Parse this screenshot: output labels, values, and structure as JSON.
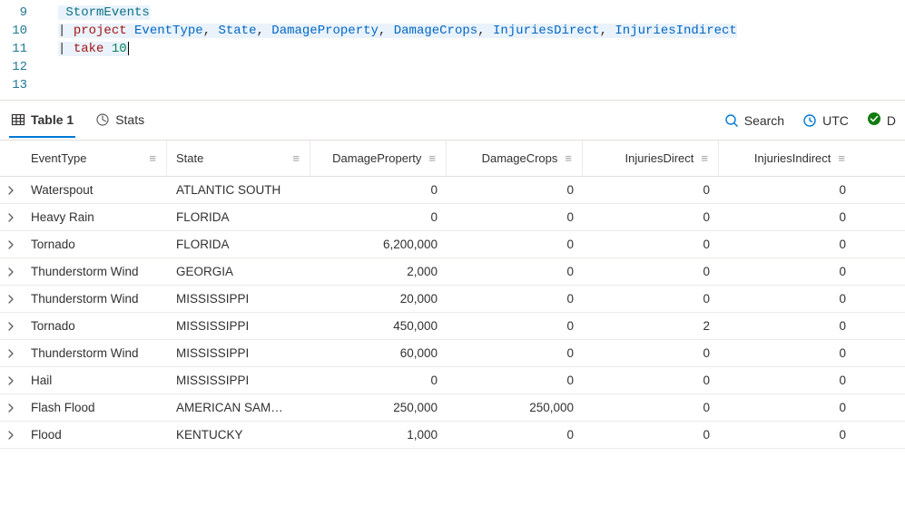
{
  "editor": {
    "lines": [
      {
        "num": "9",
        "tokens": [
          {
            "t": "StormEvents",
            "c": "tok-table"
          }
        ]
      },
      {
        "num": "10",
        "tokens": [
          {
            "t": "| ",
            "c": "tok-pipe"
          },
          {
            "t": "project ",
            "c": "tok-op"
          },
          {
            "t": "EventType",
            "c": "tok-col"
          },
          {
            "t": ", ",
            "c": "tok-punc"
          },
          {
            "t": "State",
            "c": "tok-col"
          },
          {
            "t": ", ",
            "c": "tok-punc"
          },
          {
            "t": "DamageProperty",
            "c": "tok-col"
          },
          {
            "t": ", ",
            "c": "tok-punc"
          },
          {
            "t": "DamageCrops",
            "c": "tok-col"
          },
          {
            "t": ", ",
            "c": "tok-punc"
          },
          {
            "t": "InjuriesDirect",
            "c": "tok-col"
          },
          {
            "t": ", ",
            "c": "tok-punc"
          },
          {
            "t": "InjuriesIndirect",
            "c": "tok-col"
          }
        ]
      },
      {
        "num": "11",
        "tokens": [
          {
            "t": "| ",
            "c": "tok-pipe"
          },
          {
            "t": "take ",
            "c": "tok-op"
          },
          {
            "t": "10",
            "c": "tok-num"
          }
        ],
        "cursor": true
      },
      {
        "num": "12",
        "tokens": []
      },
      {
        "num": "13",
        "tokens": []
      }
    ]
  },
  "toolbar": {
    "tab_table": "Table 1",
    "tab_stats": "Stats",
    "search": "Search",
    "utc": "UTC",
    "status_letter": "D"
  },
  "columns": [
    {
      "key": "EventType",
      "label": "EventType",
      "numeric": false
    },
    {
      "key": "State",
      "label": "State",
      "numeric": false
    },
    {
      "key": "DamageProperty",
      "label": "DamageProperty",
      "numeric": true
    },
    {
      "key": "DamageCrops",
      "label": "DamageCrops",
      "numeric": true
    },
    {
      "key": "InjuriesDirect",
      "label": "InjuriesDirect",
      "numeric": true
    },
    {
      "key": "InjuriesIndirect",
      "label": "InjuriesIndirect",
      "numeric": true
    }
  ],
  "rows": [
    {
      "EventType": "Waterspout",
      "State": "ATLANTIC SOUTH",
      "DamageProperty": "0",
      "DamageCrops": "0",
      "InjuriesDirect": "0",
      "InjuriesIndirect": "0"
    },
    {
      "EventType": "Heavy Rain",
      "State": "FLORIDA",
      "DamageProperty": "0",
      "DamageCrops": "0",
      "InjuriesDirect": "0",
      "InjuriesIndirect": "0"
    },
    {
      "EventType": "Tornado",
      "State": "FLORIDA",
      "DamageProperty": "6,200,000",
      "DamageCrops": "0",
      "InjuriesDirect": "0",
      "InjuriesIndirect": "0"
    },
    {
      "EventType": "Thunderstorm Wind",
      "State": "GEORGIA",
      "DamageProperty": "2,000",
      "DamageCrops": "0",
      "InjuriesDirect": "0",
      "InjuriesIndirect": "0"
    },
    {
      "EventType": "Thunderstorm Wind",
      "State": "MISSISSIPPI",
      "DamageProperty": "20,000",
      "DamageCrops": "0",
      "InjuriesDirect": "0",
      "InjuriesIndirect": "0"
    },
    {
      "EventType": "Tornado",
      "State": "MISSISSIPPI",
      "DamageProperty": "450,000",
      "DamageCrops": "0",
      "InjuriesDirect": "2",
      "InjuriesIndirect": "0"
    },
    {
      "EventType": "Thunderstorm Wind",
      "State": "MISSISSIPPI",
      "DamageProperty": "60,000",
      "DamageCrops": "0",
      "InjuriesDirect": "0",
      "InjuriesIndirect": "0"
    },
    {
      "EventType": "Hail",
      "State": "MISSISSIPPI",
      "DamageProperty": "0",
      "DamageCrops": "0",
      "InjuriesDirect": "0",
      "InjuriesIndirect": "0"
    },
    {
      "EventType": "Flash Flood",
      "State": "AMERICAN SAM…",
      "DamageProperty": "250,000",
      "DamageCrops": "250,000",
      "InjuriesDirect": "0",
      "InjuriesIndirect": "0"
    },
    {
      "EventType": "Flood",
      "State": "KENTUCKY",
      "DamageProperty": "1,000",
      "DamageCrops": "0",
      "InjuriesDirect": "0",
      "InjuriesIndirect": "0"
    }
  ],
  "chart_data": {
    "type": "table",
    "columns": [
      "EventType",
      "State",
      "DamageProperty",
      "DamageCrops",
      "InjuriesDirect",
      "InjuriesIndirect"
    ],
    "rows": [
      [
        "Waterspout",
        "ATLANTIC SOUTH",
        0,
        0,
        0,
        0
      ],
      [
        "Heavy Rain",
        "FLORIDA",
        0,
        0,
        0,
        0
      ],
      [
        "Tornado",
        "FLORIDA",
        6200000,
        0,
        0,
        0
      ],
      [
        "Thunderstorm Wind",
        "GEORGIA",
        2000,
        0,
        0,
        0
      ],
      [
        "Thunderstorm Wind",
        "MISSISSIPPI",
        20000,
        0,
        0,
        0
      ],
      [
        "Tornado",
        "MISSISSIPPI",
        450000,
        0,
        2,
        0
      ],
      [
        "Thunderstorm Wind",
        "MISSISSIPPI",
        60000,
        0,
        0,
        0
      ],
      [
        "Hail",
        "MISSISSIPPI",
        0,
        0,
        0,
        0
      ],
      [
        "Flash Flood",
        "AMERICAN SAM…",
        250000,
        250000,
        0,
        0
      ],
      [
        "Flood",
        "KENTUCKY",
        1000,
        0,
        0,
        0
      ]
    ]
  }
}
